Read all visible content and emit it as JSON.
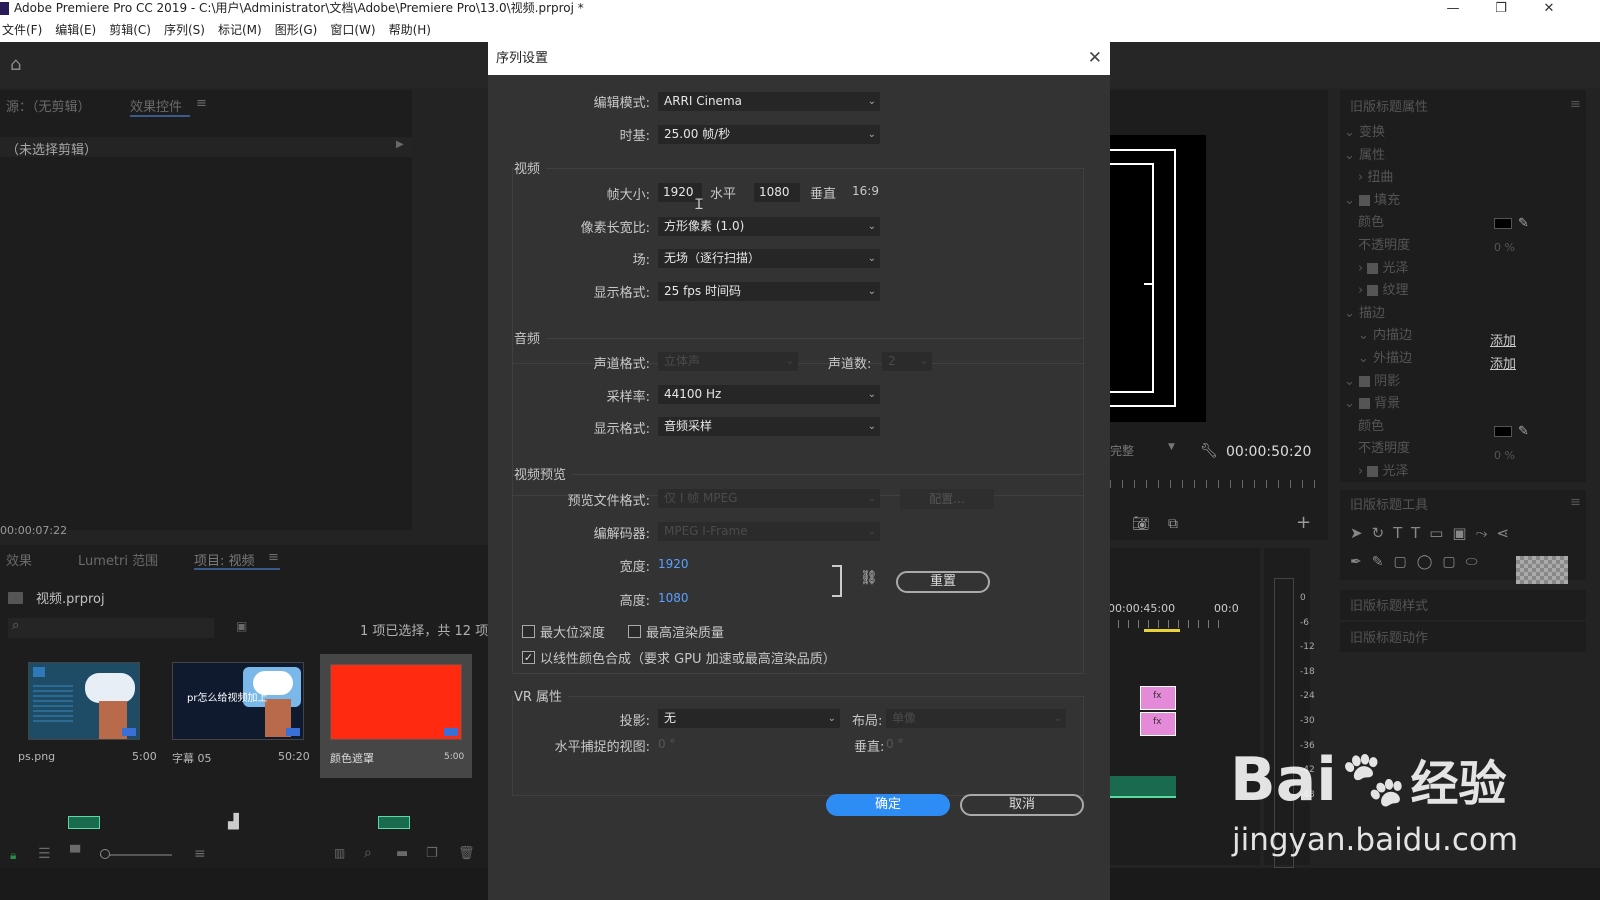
{
  "window": {
    "title": "Adobe Premiere Pro CC 2019 - C:\\用户\\Administrator\\文档\\Adobe\\Premiere Pro\\13.0\\视频.prproj *"
  },
  "menu": [
    "文件(F)",
    "编辑(E)",
    "剪辑(C)",
    "序列(S)",
    "标记(M)",
    "图形(G)",
    "窗口(W)",
    "帮助(H)"
  ],
  "left_panel": {
    "tabs": [
      "源：（无剪辑）",
      "效果控件"
    ],
    "no_clip": "（未选择剪辑）",
    "timecode": "00:00:07:22"
  },
  "project_panel": {
    "tabs": [
      "效果",
      "Lumetri 范围",
      "项目: 视频"
    ],
    "file": "视频.prproj",
    "selection": "1 项已选择，共 12 项",
    "items": [
      {
        "name": "ps.png",
        "duration": "5:00",
        "caption": "",
        "color": "#1e4b66"
      },
      {
        "name": "字幕 05",
        "duration": "50:20",
        "caption": "pr怎么给视频加上",
        "color": "#0f1a2e"
      },
      {
        "name": "颜色遮罩",
        "duration": "5:00",
        "caption": "",
        "color": "#ff2a10"
      }
    ]
  },
  "dialog": {
    "title": "序列设置",
    "editing_mode_label": "编辑模式:",
    "editing_mode": "ARRI Cinema",
    "timebase_label": "时基:",
    "timebase": "25.00  帧/秒",
    "video_section": "视频",
    "frame_size_label": "帧大小:",
    "frame_width": "1920",
    "horizontal": "水平",
    "frame_height": "1080",
    "vertical": "垂直",
    "aspect": "16:9",
    "pixel_aspect_label": "像素长宽比:",
    "pixel_aspect": "方形像素 (1.0)",
    "fields_label": "场:",
    "fields": "无场（逐行扫描）",
    "display_format_label": "显示格式:",
    "display_format": "25 fps 时间码",
    "audio_section": "音频",
    "channel_format_label": "声道格式:",
    "channel_format": "立体声",
    "channels_label": "声道数:",
    "channels": "2",
    "sample_rate_label": "采样率:",
    "sample_rate": "44100 Hz",
    "audio_display_label": "显示格式:",
    "audio_display": "音频采样",
    "preview_section": "视频预览",
    "preview_format_label": "预览文件格式:",
    "preview_format": "仅 I 帧 MPEG",
    "configure": "配置...",
    "codec_label": "编解码器:",
    "codec": "MPEG I-Frame",
    "width_label": "宽度:",
    "width": "1920",
    "height_label": "高度:",
    "height": "1080",
    "reset": "重置",
    "max_bit_depth": "最大位深度",
    "max_render_quality": "最高渲染质量",
    "linear_color": "以线性颜色合成（要求 GPU 加速或最高渲染品质）",
    "vr_section": "VR 属性",
    "projection_label": "投影:",
    "projection": "无",
    "layout_label": "布局:",
    "layout": "单像",
    "h_view_label": "水平捕捉的视图:",
    "h_view": "0 °",
    "v_label": "垂直:",
    "v_view": "0 °",
    "ok": "确定",
    "cancel": "取消"
  },
  "program_monitor": {
    "timecode": "00:00:50:20",
    "fit_dropdown": "完整"
  },
  "timeline": {
    "time1": "00:00:45:00",
    "time2": "00:0",
    "meter_ticks": [
      "0",
      "-6",
      "-12",
      "-18",
      "-24",
      "-30",
      "-36",
      "-42",
      "-48"
    ]
  },
  "right_panel": {
    "title": "旧版标题属性",
    "items": [
      "变换",
      "属性",
      "扭曲",
      "填充",
      "颜色",
      "不透明度",
      "光泽",
      "纹理",
      "描边",
      "内描边",
      "外描边",
      "阴影",
      "背景",
      "颜色",
      "不透明度",
      "光泽"
    ],
    "opacity1": "0 %",
    "opacity2": "0 %",
    "add1": "添加",
    "add2": "添加",
    "tools_title": "旧版标题工具",
    "styles_title": "旧版标题样式",
    "actions_title": "旧版标题动作"
  },
  "watermark": {
    "brand": "Bai",
    "brand_tail": "经验",
    "url": "jingyan.baidu.com"
  }
}
